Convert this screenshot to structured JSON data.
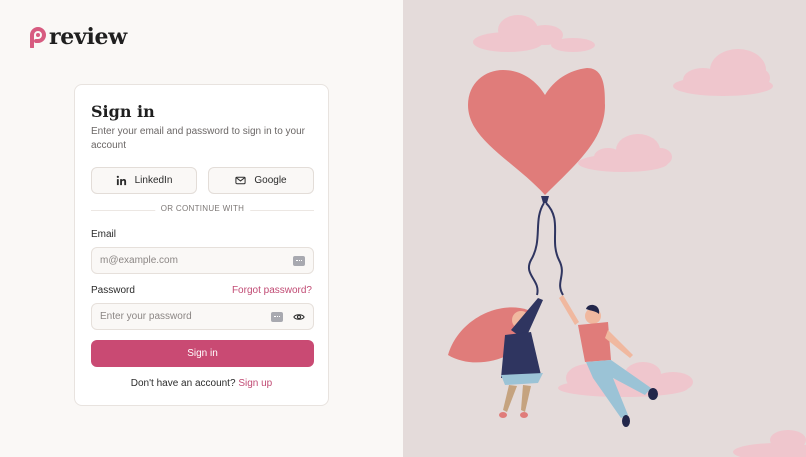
{
  "brand": {
    "name": "review",
    "accent": "#c94a73",
    "logo_color": "#d75b80"
  },
  "signin": {
    "title": "Sign in",
    "subtitle": "Enter your email and password to sign in to your account",
    "oauth": [
      {
        "label": "LinkedIn",
        "icon": "linkedin-icon"
      },
      {
        "label": "Google",
        "icon": "mail-icon"
      }
    ],
    "divider": "OR CONTINUE WITH",
    "email": {
      "label": "Email",
      "placeholder": "m@example.com"
    },
    "password": {
      "label": "Password",
      "placeholder": "Enter your password",
      "forgot": "Forgot password?"
    },
    "submit": "Sign in",
    "footer": {
      "prompt": "Don't have an account?",
      "link": "Sign up"
    }
  },
  "illustration": {
    "background": "#e4dbda",
    "subject": "couple floating with heart balloon",
    "balloon_color": "#e07c7a",
    "cloud_color": "#efc6cd"
  }
}
